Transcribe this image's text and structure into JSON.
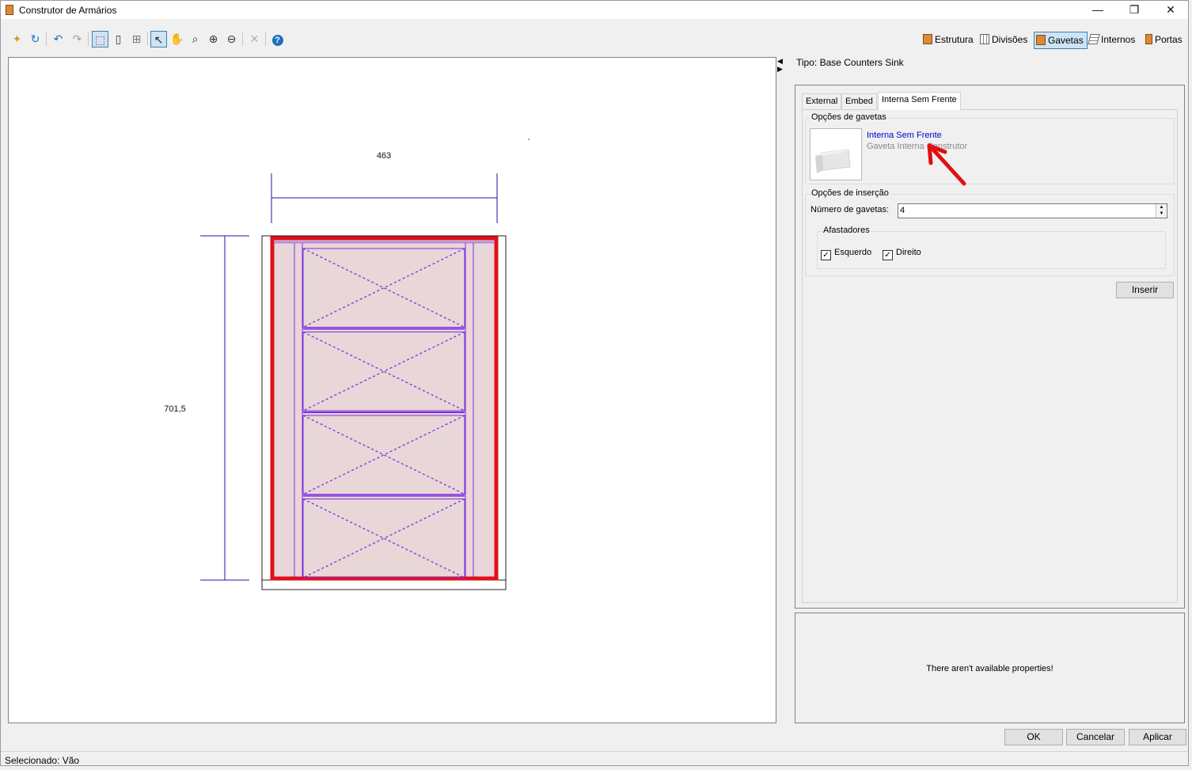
{
  "window": {
    "title": "Construtor de Armários",
    "minimize_glyph": "—",
    "restore_glyph": "❐",
    "close_glyph": "✕"
  },
  "toolbar": {
    "tools": [
      {
        "name": "new-icon",
        "glyph": "✦"
      },
      {
        "name": "refresh-icon",
        "glyph": "↻"
      },
      {
        "name": "undo-icon",
        "glyph": "↶"
      },
      {
        "name": "redo-icon",
        "glyph": "↷"
      },
      {
        "name": "select-area-icon",
        "glyph": "⬚"
      },
      {
        "name": "frame-icon",
        "glyph": "▯"
      },
      {
        "name": "grid-icon",
        "glyph": "⊞"
      },
      {
        "name": "pointer-icon",
        "glyph": "↖"
      },
      {
        "name": "pan-hand-icon",
        "glyph": "✋"
      },
      {
        "name": "zoom-fit-icon",
        "glyph": "⌕"
      },
      {
        "name": "zoom-in-icon",
        "glyph": "⊕"
      },
      {
        "name": "zoom-out-icon",
        "glyph": "⊖"
      },
      {
        "name": "delete-icon",
        "glyph": "✕"
      },
      {
        "name": "help-icon",
        "glyph": "?"
      }
    ],
    "modes": [
      {
        "label": "Estrutura",
        "icon": "cabinet-icon",
        "active": false
      },
      {
        "label": "Divisões",
        "icon": "divisions-grid-icon",
        "active": false
      },
      {
        "label": "Gavetas",
        "icon": "drawers-icon",
        "active": true
      },
      {
        "label": "Internos",
        "icon": "shelves-icon",
        "active": false
      },
      {
        "label": "Portas",
        "icon": "door-icon",
        "active": false
      }
    ]
  },
  "canvas": {
    "width_dimension": "463",
    "height_dimension": "701,5",
    "drawer_count": 4
  },
  "panel": {
    "tipo_label": "Tipo: Base Counters Sink",
    "collapse_left": "◀",
    "collapse_right": "▶",
    "tabs": [
      {
        "label": "External",
        "selected": false
      },
      {
        "label": "Embed",
        "selected": false
      },
      {
        "label": "Interna Sem Frente",
        "selected": true
      }
    ],
    "drawer_options": {
      "group_label": "Opções de gavetas",
      "item_title": "Interna Sem Frente",
      "item_subtitle": "Gaveta Interna Construtor"
    },
    "insert_options": {
      "group_label": "Opções de inserção",
      "count_label": "Número de gavetas:",
      "count_value": "4",
      "spacers_label": "Afastadores",
      "left_label": "Esquerdo",
      "left_checked": true,
      "right_label": "Direito",
      "right_checked": true
    },
    "insert_button": "Inserir"
  },
  "properties": {
    "message": "There aren't available properties!"
  },
  "footer": {
    "ok": "OK",
    "cancel": "Cancelar",
    "apply": "Aplicar"
  },
  "status": {
    "text": "Selecionado: Vão"
  },
  "colors": {
    "accent": "#3c7fb1",
    "selection_red": "#e0101a",
    "drawer_purple": "#7d2ee0",
    "dimension_blue": "#1a1aa8",
    "fill_pink": "#e8d6d8"
  }
}
